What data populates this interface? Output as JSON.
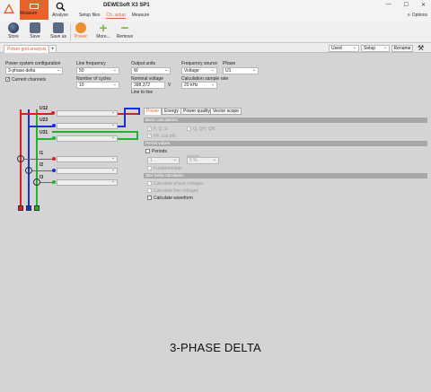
{
  "app": {
    "title": "DEWESoft X3 SP1",
    "measure_label": "Measure",
    "analyse_label": "Analyse",
    "options_label": "Options"
  },
  "nav": {
    "items": [
      "Setup files",
      "Ch. setup",
      "Measure"
    ],
    "active": "Ch. setup"
  },
  "toolbar": {
    "store": "Store",
    "save": "Save",
    "save_as": "Save as",
    "power": "Power",
    "more": "More...",
    "remove": "Remove"
  },
  "tabs": {
    "active": "Power grid analysis 1",
    "add": "+"
  },
  "right_controls": {
    "used": "Used",
    "setup": "Setup",
    "rename": "Rename"
  },
  "config": {
    "system_label": "Power system configuration",
    "system_value": "3-phase delta",
    "current_channels": "Current channels",
    "current_channels_checked": true,
    "line_freq_label": "Line frequency",
    "line_freq_value": "50",
    "num_cycles_label": "Number of cycles",
    "num_cycles_value": "10",
    "output_units_label": "Output units",
    "output_units_value": "W",
    "nominal_voltage_label": "Nominal voltage",
    "nominal_voltage_value": "398,372",
    "nominal_voltage_unit": "V",
    "line_to_line": "Line to line",
    "freq_source_label": "Frequency source",
    "freq_source_value": "Voltage",
    "calc_rate_label": "Calculation sample rate",
    "calc_rate_value": "20 kHz",
    "phase_label": "Phase",
    "phase_value": "U1"
  },
  "channels": {
    "u12": "U12",
    "u23": "U23",
    "u31": "U31",
    "i1": "I1",
    "i2": "I2",
    "i3": "I3"
  },
  "panel": {
    "tabs": [
      "Power",
      "Energy",
      "Power quality",
      "Vector scope"
    ],
    "basic_calc": "Basic calculations",
    "p_q_s": "P, Q, S",
    "q_qh_qn": "Q, QH, QN",
    "pf_cos": "PF, cos phi",
    "period_values": "Period values",
    "periods": "Periods",
    "periods_count": "1",
    "overlap_label": "Overlap",
    "overlap_value": "0 %",
    "fundamentals": "Fundamentals",
    "star_delta": "Star-Delta calculation",
    "calc_phase": "Calculate phase voltages",
    "calc_line": "Calculate line voltages",
    "calc_waveform": "Calculate waveform"
  },
  "footer": {
    "caption": "3-PHASE DELTA"
  },
  "colors": {
    "accent": "#e8622c",
    "phase1": "#e01b1b",
    "phase2": "#1433d4",
    "phase3": "#22b22c"
  }
}
